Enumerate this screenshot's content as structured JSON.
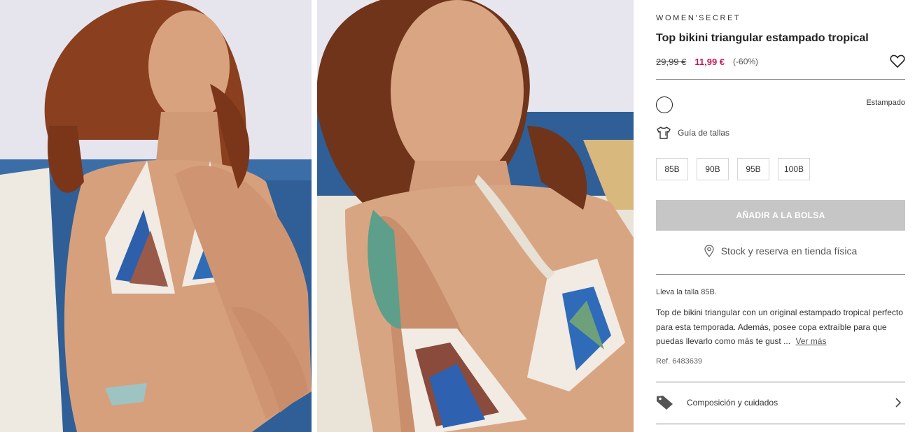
{
  "product": {
    "brand": "WOMEN'SECRET",
    "title": "Top bikini triangular estampado tropical",
    "price_old": "29,99 €",
    "price_new": "11,99 €",
    "discount": "(-60%)",
    "color_name": "Estampado",
    "size_guide_label": "Guía de tallas",
    "sizes": [
      "85B",
      "90B",
      "95B",
      "100B"
    ],
    "add_to_bag": "AÑADIR A LA BOLSA",
    "store_label": "Stock y reserva en tienda física",
    "model_wears": "Lleva la talla 85B.",
    "description": "Top de bikini triangular con un original estampado tropical perfecto para esta temporada. Además, posee copa extraíble para que puedas llevarlo como más te gust ...",
    "see_more": "Ver más",
    "reference": "Ref. 6483639",
    "composition_label": "Composición y cuidados"
  },
  "gallery": {
    "images": [
      "model-photo-full-body",
      "model-photo-closeup"
    ]
  },
  "icons": {
    "wishlist": "heart-icon",
    "size_guide": "tshirt-icon",
    "store": "location-pin-icon",
    "composition": "tag-icon",
    "composition_arrow": "chevron-right-icon"
  },
  "colors": {
    "sale_price": "#c2185b",
    "add_to_bag_bg": "#c6c6c6",
    "sea": "#2f5f96",
    "sky": "#e7e6ee"
  }
}
